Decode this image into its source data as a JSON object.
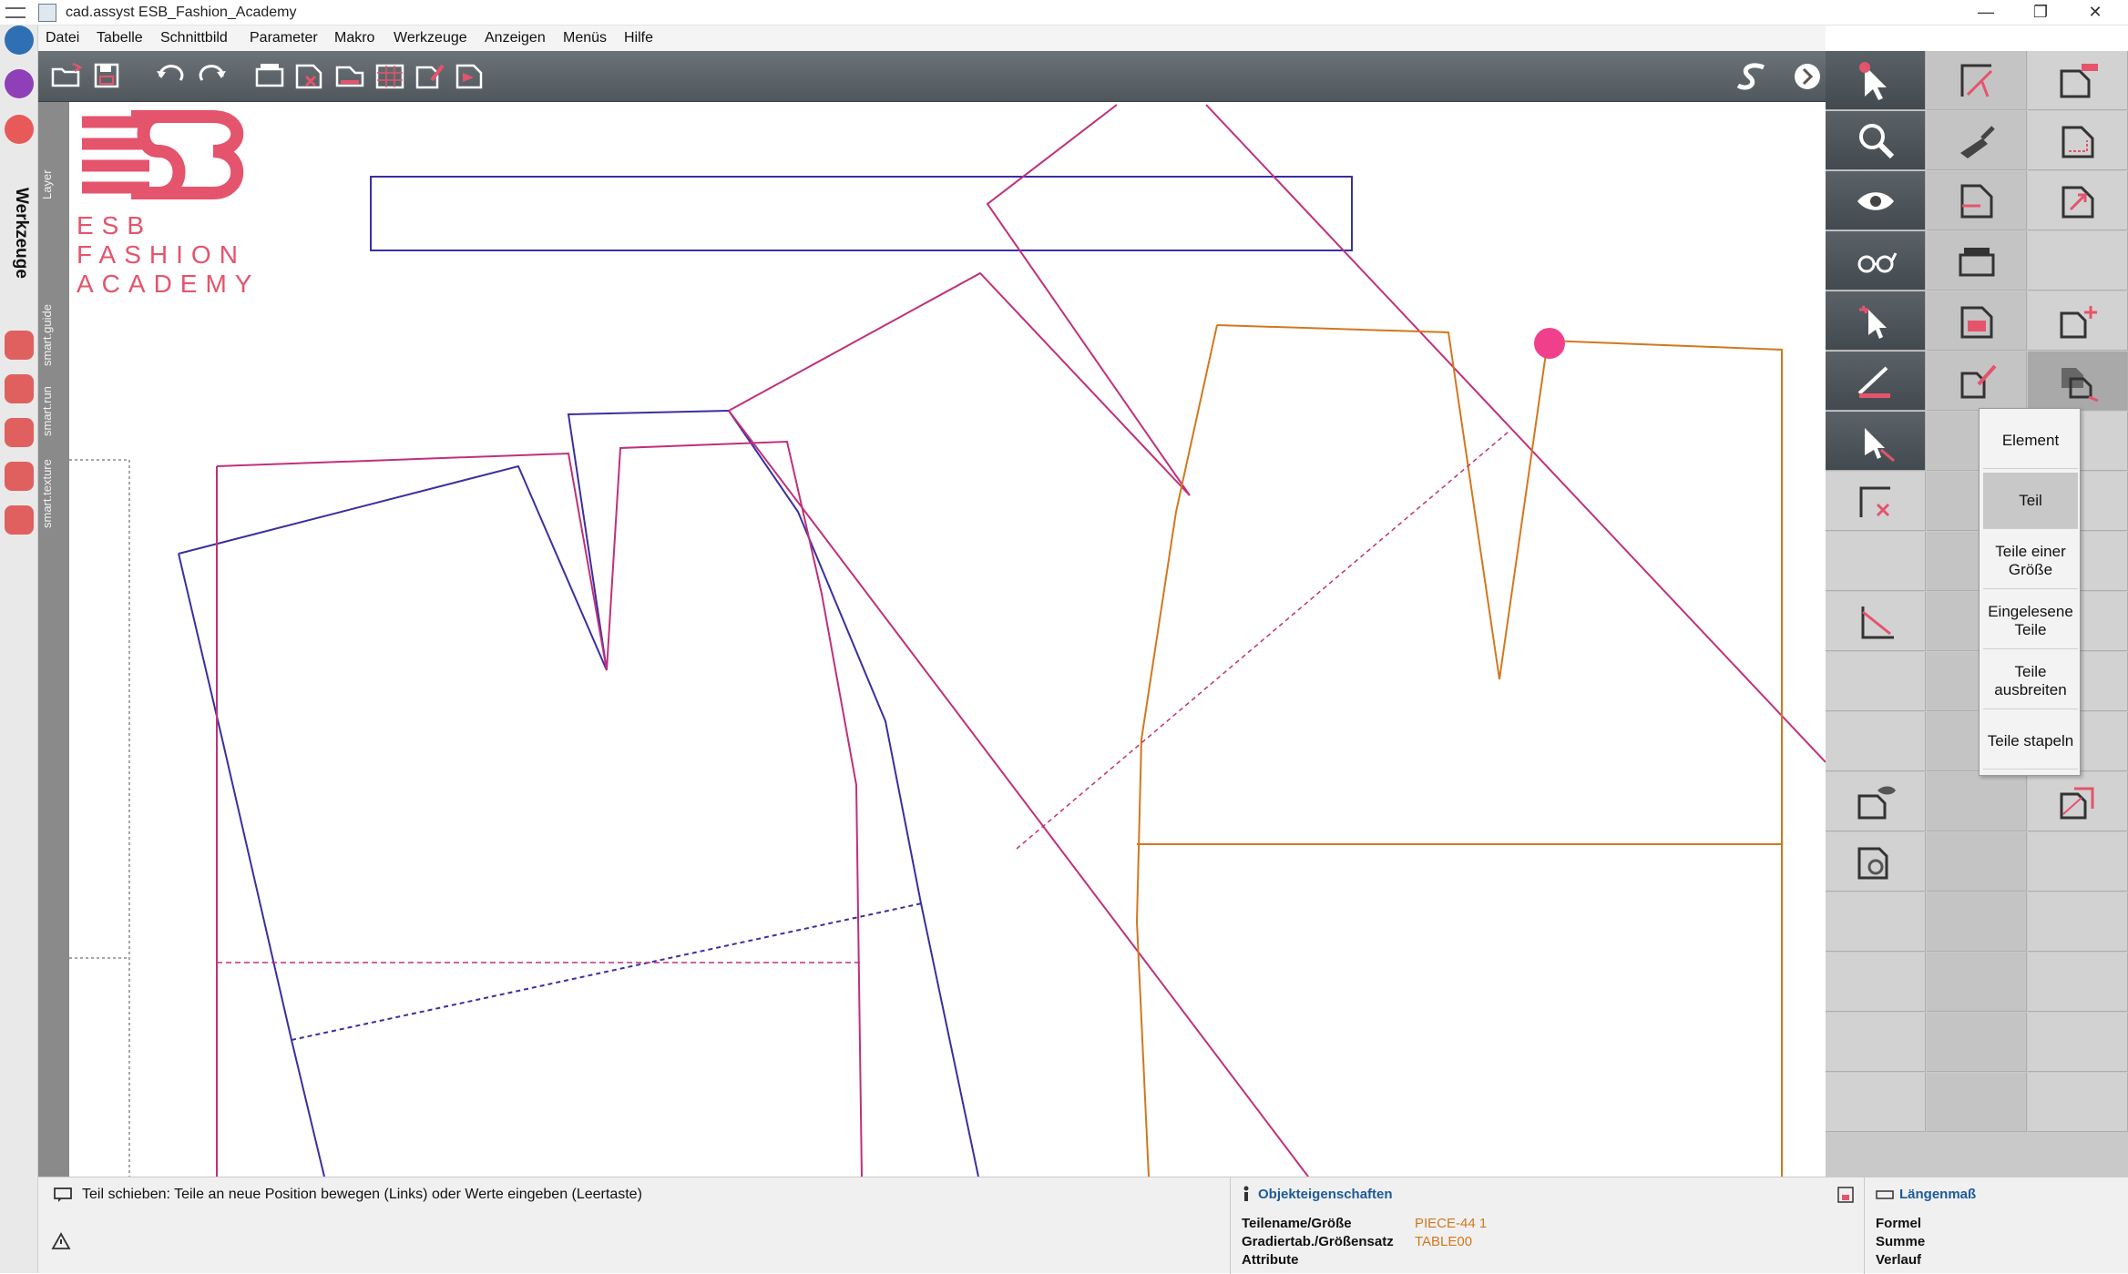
{
  "window": {
    "title": "cad.assyst  ESB_Fashion_Academy",
    "minimize": "—",
    "maximize": "❐",
    "close": "✕"
  },
  "menubar": {
    "items": [
      "Datei",
      "Tabelle",
      "Schnittbild",
      "Parameter",
      "Makro",
      "Werkzeuge",
      "Anzeigen",
      "Menüs",
      "Hilfe"
    ]
  },
  "leftpanel": {
    "label": "Werkzeuge"
  },
  "layer_tabs": [
    "Layer",
    "smart.guide",
    "smart.run",
    "smart.texture"
  ],
  "logo": {
    "line1": "ESB",
    "line2": "FASHION",
    "line3": "ACADEMY"
  },
  "flyout": {
    "items": [
      {
        "label": "Element",
        "active": false
      },
      {
        "label": "Teil",
        "active": true
      },
      {
        "label": "Teile einer Größe",
        "active": false
      },
      {
        "label": "Eingelesene Teile",
        "active": false
      },
      {
        "label": "Teile ausbreiten",
        "active": false
      },
      {
        "label": "Teile stapeln",
        "active": false
      }
    ]
  },
  "status": {
    "message": "Teil schieben: Teile an neue Position bewegen (Links) oder Werte eingeben (Leertaste)"
  },
  "object_properties": {
    "title": "Objekteigenschaften",
    "rows": [
      {
        "key": "Teilename/Größe",
        "value": "PIECE-44 1"
      },
      {
        "key": "Gradiertab./Größensatz",
        "value": "TABLE00"
      },
      {
        "key": "Attribute",
        "value": ""
      }
    ]
  },
  "length_measure": {
    "title": "Längenmaß",
    "rows": [
      "Formel",
      "Summe",
      "Verlauf"
    ]
  },
  "colors": {
    "accent": "#e4546c",
    "piece_blue": "#3a2fa0",
    "piece_magenta": "#c0307a",
    "piece_orange": "#d2781e"
  }
}
